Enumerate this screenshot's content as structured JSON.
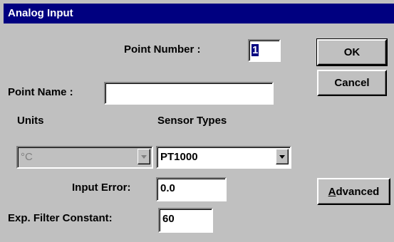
{
  "window": {
    "title": "Analog Input"
  },
  "point_number": {
    "label": "Point Number :",
    "value": "1"
  },
  "point_name": {
    "label": "Point Name :",
    "value": ""
  },
  "units": {
    "label": "Units",
    "selected": "°C"
  },
  "sensor_types": {
    "label": "Sensor Types",
    "selected": "PT1000"
  },
  "input_error": {
    "label": "Input Error:",
    "value": "0.0"
  },
  "filter_constant": {
    "label": "Exp. Filter Constant:",
    "value": "60"
  },
  "buttons": {
    "ok": "OK",
    "cancel": "Cancel",
    "advanced_mnemonic": "A",
    "advanced_rest": "dvanced"
  },
  "icons": {
    "dropdown": "chevron-down-icon"
  }
}
